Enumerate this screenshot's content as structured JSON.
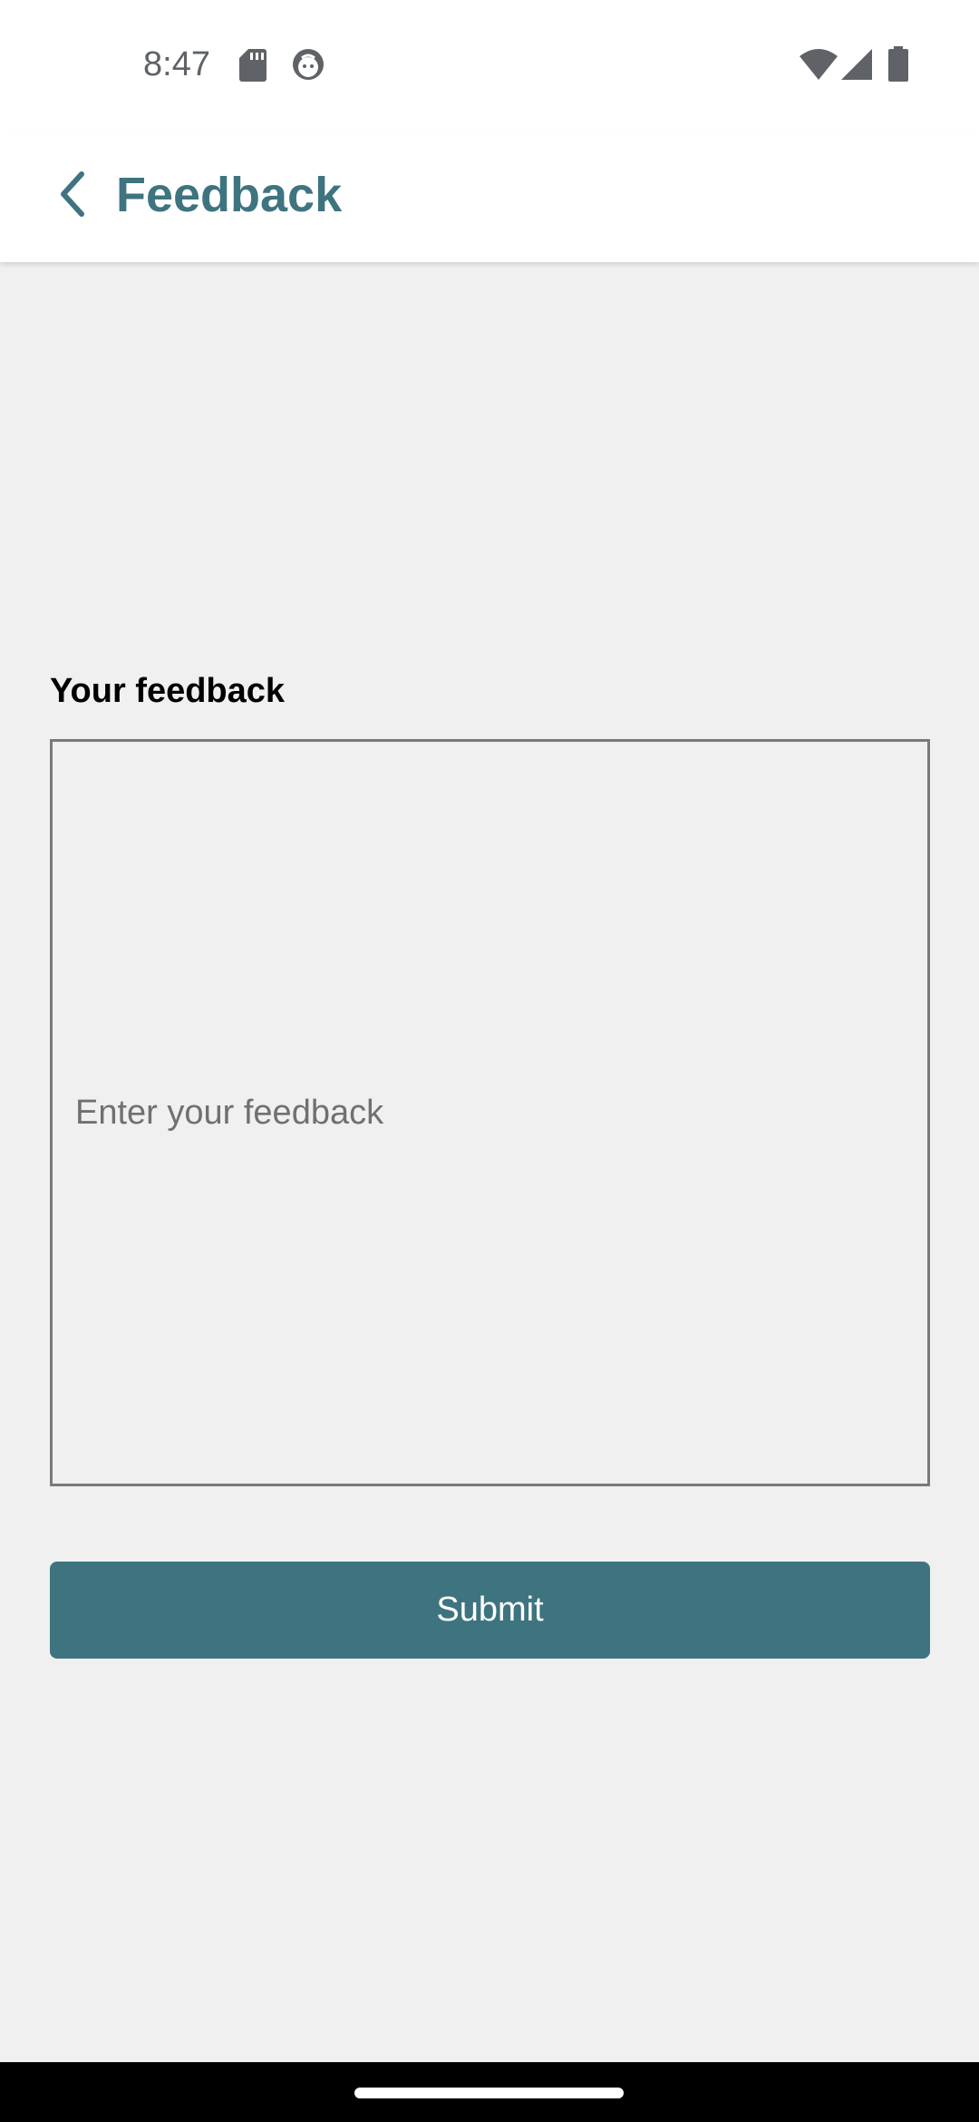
{
  "status_bar": {
    "time": "8:47",
    "icons": [
      "sd-card-icon",
      "notification-face-icon",
      "wifi-icon",
      "cell-signal-icon",
      "battery-icon"
    ]
  },
  "app_bar": {
    "title": "Feedback",
    "back_icon": "chevron-left-icon"
  },
  "form": {
    "label": "Your feedback",
    "input_value": "",
    "input_placeholder": "Enter your feedback",
    "submit_label": "Submit"
  },
  "colors": {
    "accent": "#3e7480",
    "background": "#f0f0f0",
    "surface": "#ffffff",
    "input_border": "#7a7a7a"
  }
}
